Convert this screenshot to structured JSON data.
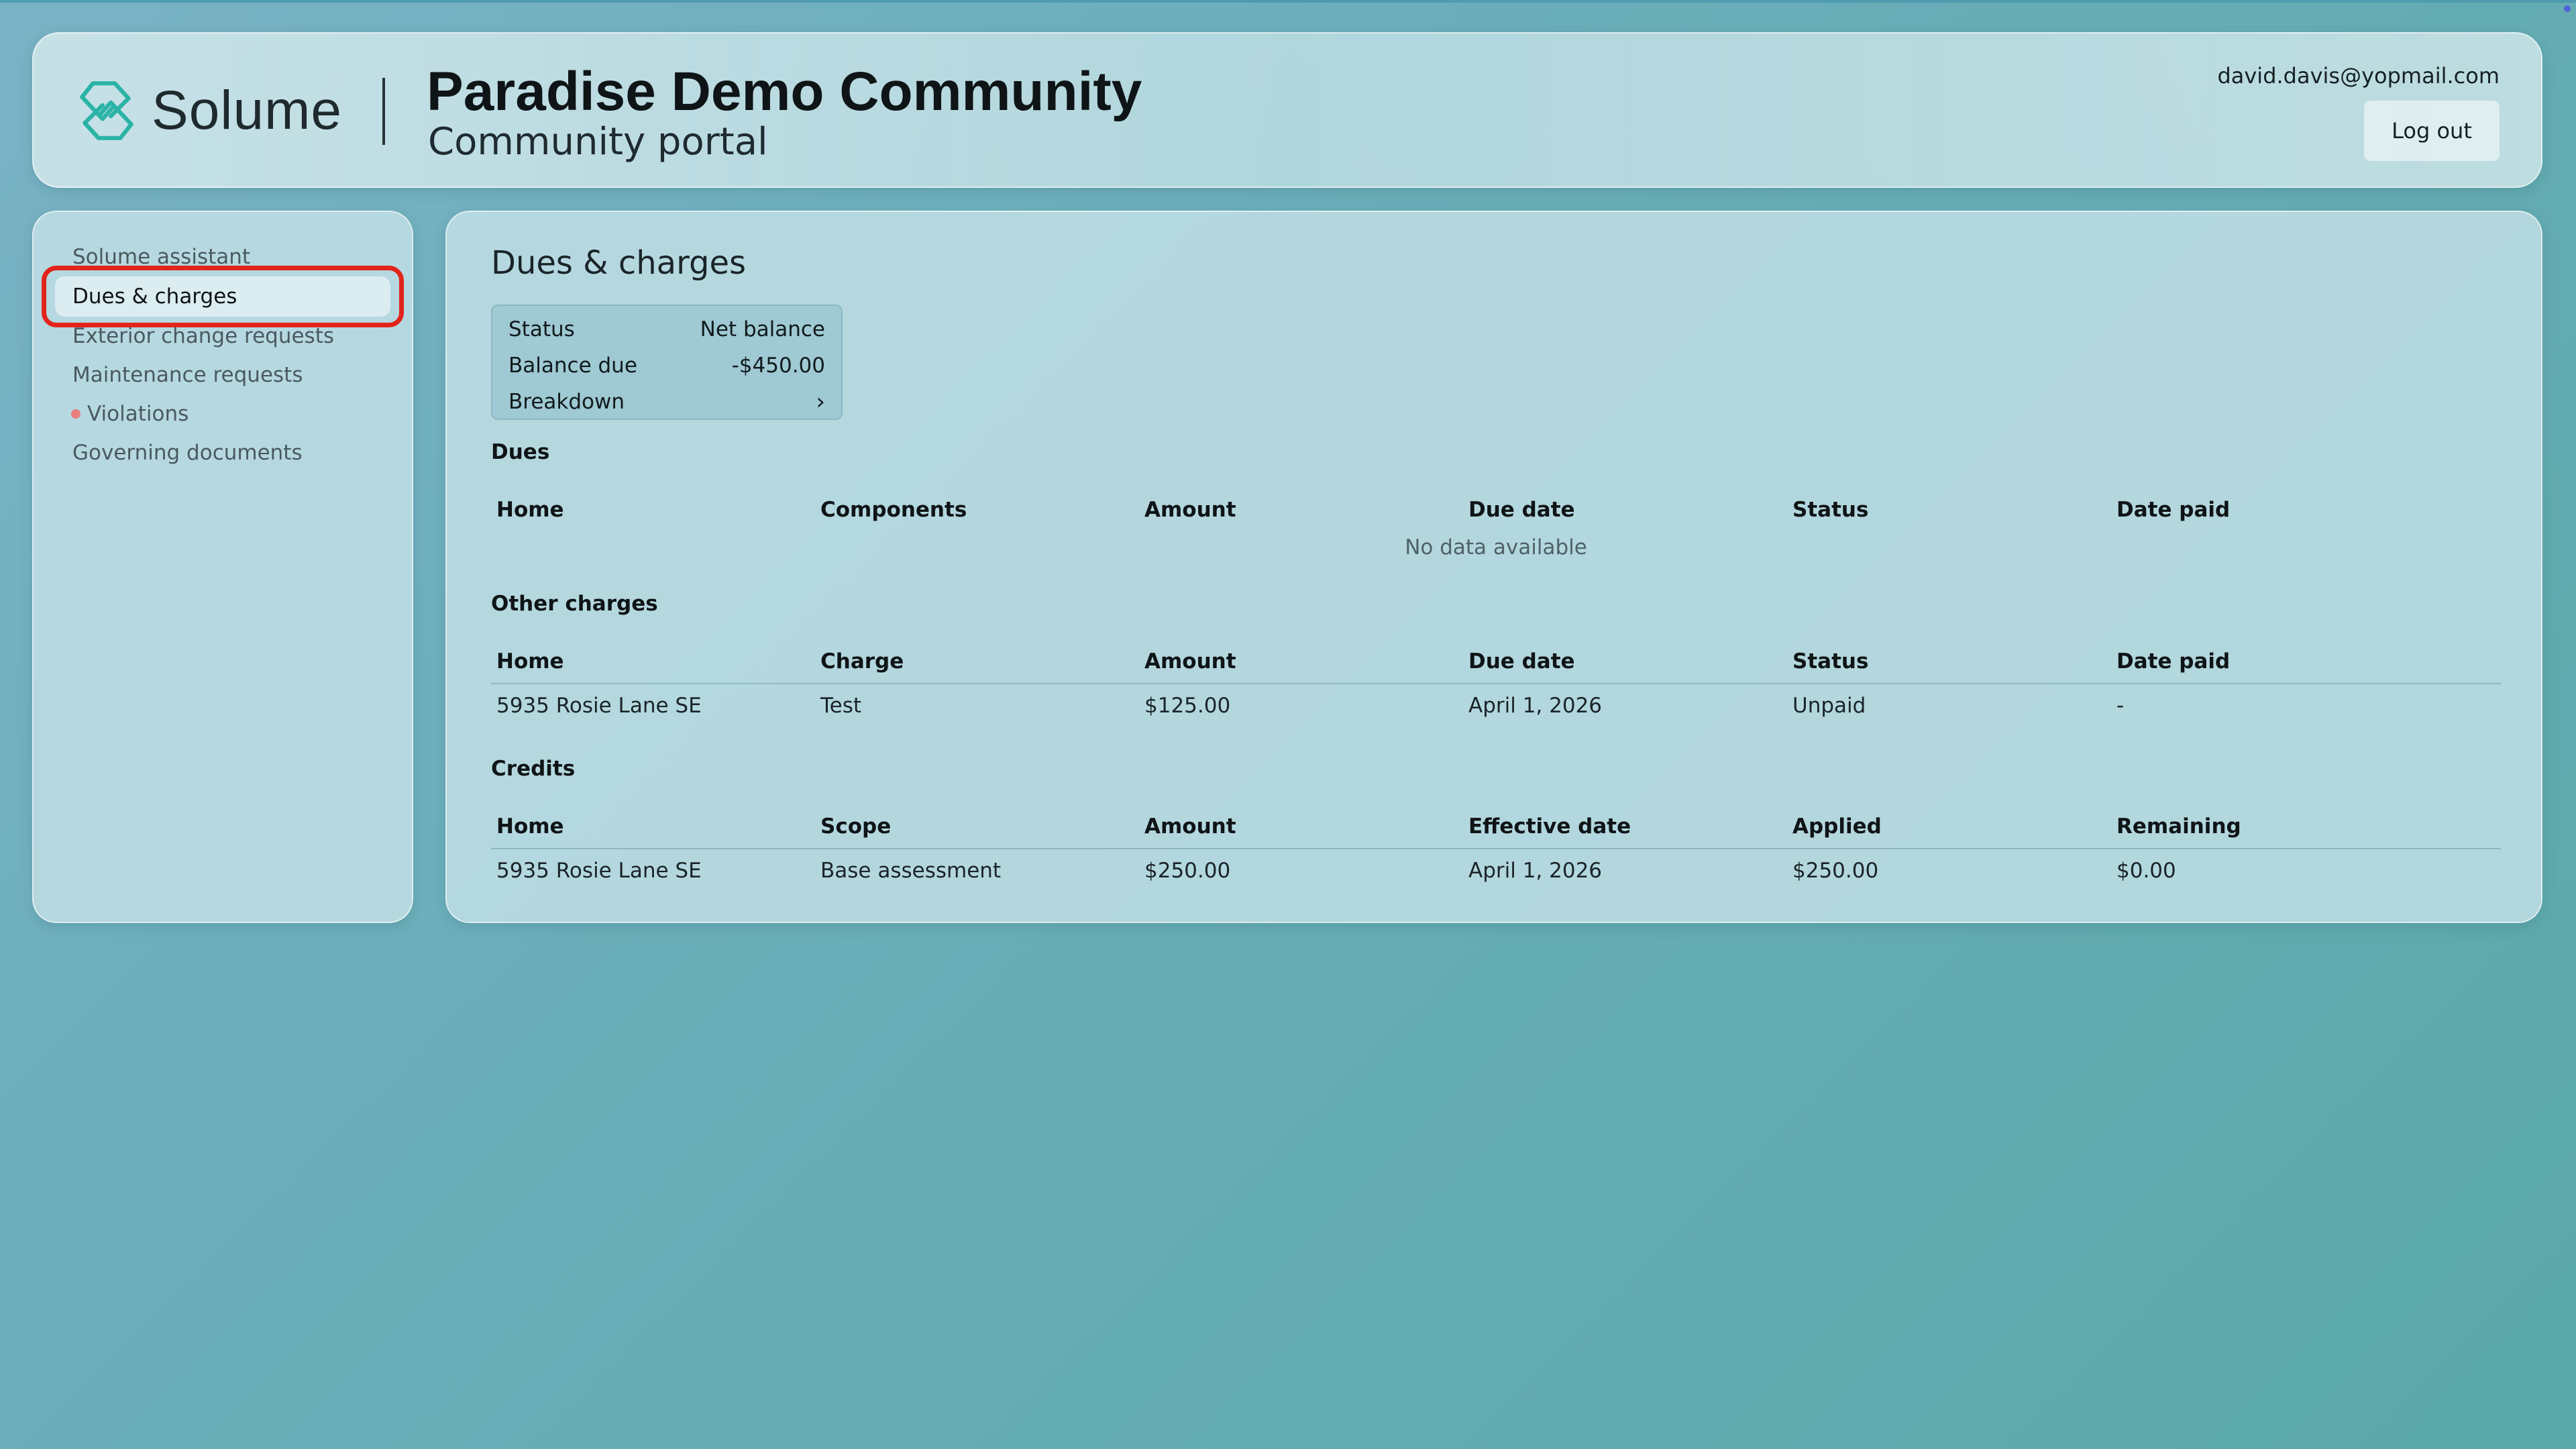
{
  "header": {
    "brand": "Solume",
    "community_name": "Paradise Demo Community",
    "portal_label": "Community portal",
    "user_email": "david.davis@yopmail.com",
    "logout_label": "Log out"
  },
  "sidebar": {
    "items": [
      {
        "label": "Solume assistant",
        "active": false
      },
      {
        "label": "Dues & charges",
        "active": true
      },
      {
        "label": "Exterior change requests",
        "active": false
      },
      {
        "label": "Maintenance requests",
        "active": false
      },
      {
        "label": "Violations",
        "active": false,
        "indicator": "red-dot"
      },
      {
        "label": "Governing documents",
        "active": false
      }
    ]
  },
  "main": {
    "title": "Dues & charges",
    "summary": {
      "status_label": "Status",
      "status_value": "Net balance",
      "balance_label": "Balance due",
      "balance_value": "-$450.00",
      "breakdown_label": "Breakdown",
      "breakdown_icon": "chevron-right-icon"
    },
    "dues": {
      "title": "Dues",
      "columns": [
        "Home",
        "Components",
        "Amount",
        "Due date",
        "Status",
        "Date paid"
      ],
      "empty_text": "No data available"
    },
    "other_charges": {
      "title": "Other charges",
      "columns": [
        "Home",
        "Charge",
        "Amount",
        "Due date",
        "Status",
        "Date paid"
      ],
      "rows": [
        [
          "5935 Rosie Lane SE",
          "Test",
          "$125.00",
          "April 1, 2026",
          "Unpaid",
          "-"
        ]
      ]
    },
    "credits": {
      "title": "Credits",
      "columns": [
        "Home",
        "Scope",
        "Amount",
        "Effective date",
        "Applied",
        "Remaining"
      ],
      "rows": [
        [
          "5935 Rosie Lane SE",
          "Base assessment",
          "$250.00",
          "April 1, 2026",
          "$250.00",
          "$0.00"
        ]
      ]
    }
  },
  "colors": {
    "background_start": "#79b2c5",
    "background_end": "#5aa8a9",
    "highlight_outline": "#e2241b",
    "violation_dot": "#e87f7f",
    "logo_accent": "#2ab3a6"
  }
}
